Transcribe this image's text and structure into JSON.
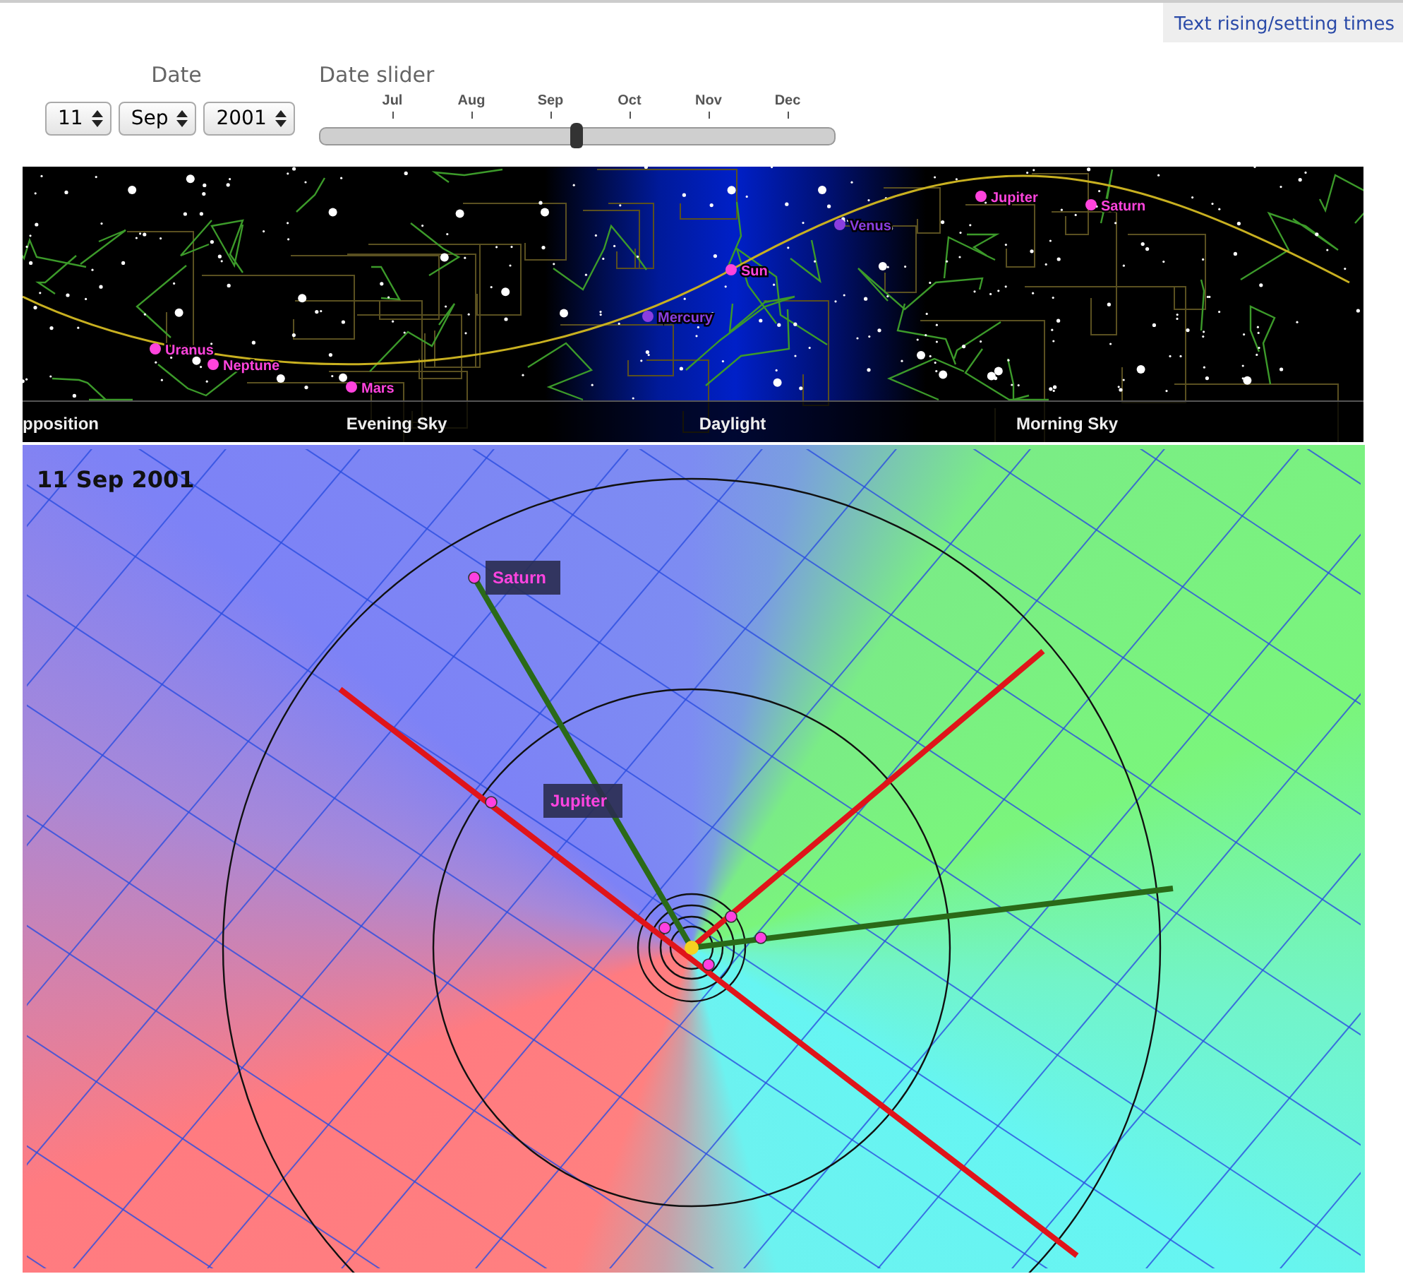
{
  "help_box": {
    "link": "Text rising/setting times"
  },
  "date": {
    "label": "Date",
    "day": "11",
    "month": "Sep",
    "year": "2001"
  },
  "date_slider": {
    "label": "Date slider",
    "months": [
      "Jul",
      "Aug",
      "Sep",
      "Oct",
      "Nov",
      "Dec"
    ],
    "level": 0.5
  },
  "sky_map": {
    "planets": [
      {
        "name": "Uranus",
        "color": "#ff44dd"
      },
      {
        "name": "Neptune",
        "color": "#ff44dd"
      },
      {
        "name": "Mars",
        "color": "#ff44dd"
      },
      {
        "name": "Mercury",
        "color": "#8a3ee0"
      },
      {
        "name": "Sun",
        "color": "#ff44dd"
      },
      {
        "name": "Venus",
        "color": "#8a3ee0"
      },
      {
        "name": "Jupiter",
        "color": "#ff44dd"
      },
      {
        "name": "Saturn",
        "color": "#ff44dd"
      }
    ],
    "bands": [
      "pposition",
      "Evening Sky",
      "Daylight",
      "Morning Sky"
    ]
  },
  "orbit_view": {
    "date": "11 Sep 2001",
    "labels": [
      "Saturn",
      "Jupiter"
    ]
  }
}
